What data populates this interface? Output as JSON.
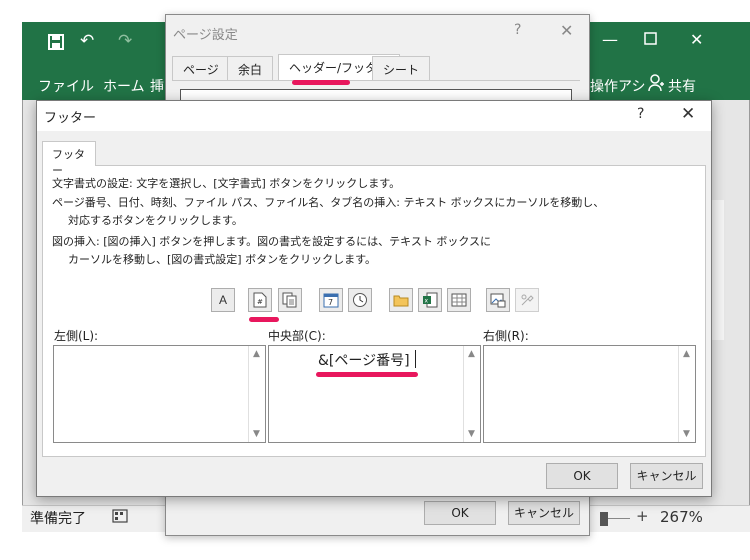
{
  "excel": {
    "menu": [
      "ファイル",
      "ホーム",
      "挿"
    ],
    "right_menu": "操作アシ",
    "share": "共有",
    "status": "準備完了",
    "zoom": "267%"
  },
  "page_setup": {
    "title": "ページ設定",
    "help": "?",
    "close": "✕",
    "tabs": [
      "ページ",
      "余白",
      "ヘッダー/フッター",
      "シート"
    ],
    "ok": "OK",
    "cancel": "キャンセル"
  },
  "footer_dialog": {
    "title": "フッター",
    "help": "?",
    "close": "✕",
    "tab": "フッター",
    "instructions": [
      "文字書式の設定: 文字を選択し、[文字書式] ボタンをクリックします。",
      "ページ番号、日付、時刻、ファイル パス、ファイル名、タブ名の挿入: テキスト ボックスにカーソルを移動し、",
      "対応するボタンをクリックします。",
      "図の挿入: [図の挿入] ボタンを押します。図の書式を設定するには、テキスト ボックスに",
      "カーソルを移動し、[図の書式設定] ボタンをクリックします。"
    ],
    "toolbar_font_glyph": "A",
    "left_label": "左側(L):",
    "center_label": "中央部(C):",
    "right_label": "右側(R):",
    "center_value": "&[ページ番号]",
    "ok": "OK",
    "cancel": "キャンセル"
  },
  "colors": {
    "excel_green": "#217346",
    "highlight": "#e8175d"
  }
}
